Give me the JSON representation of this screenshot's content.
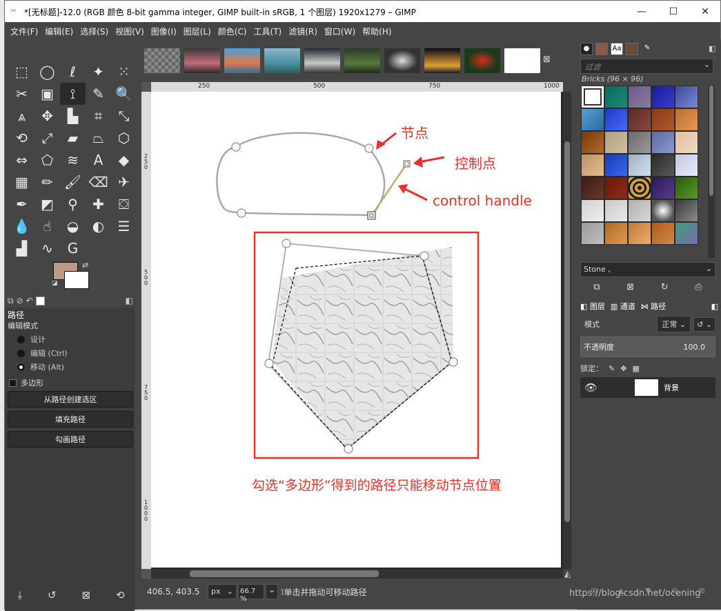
{
  "window": {
    "title": "*[无标题]-12.0 (RGB 颜色 8-bit gamma integer, GIMP built-in sRGB, 1 个图层) 1920x1279 – GIMP",
    "controls": {
      "minimize": "—",
      "maximize": "☐",
      "close": "✕"
    }
  },
  "menubar": {
    "items": [
      "文件(F)",
      "编辑(E)",
      "选择(S)",
      "视图(V)",
      "图像(I)",
      "图层(L)",
      "颜色(C)",
      "工具(T)",
      "滤镜(R)",
      "窗口(W)",
      "帮助(H)"
    ]
  },
  "ruler": {
    "h_labels": [
      "250",
      "500",
      "750",
      "1000"
    ],
    "v_labels": [
      "2\n5\n0",
      "5\n0\n0",
      "7\n5\n0",
      "1\n0\n0\n0"
    ]
  },
  "tool_options": {
    "title": "路径",
    "edit_mode_label": "编辑模式",
    "modes": [
      {
        "label": "设计",
        "checked": false
      },
      {
        "label": "编辑 (Ctrl)",
        "checked": false
      },
      {
        "label": "移动 (Alt)",
        "checked": true
      }
    ],
    "polygon_label": "多边形",
    "buttons": [
      "从路径创建选区",
      "填充路径",
      "勾画路径"
    ]
  },
  "status": {
    "coords": "406.5, 403.5",
    "unit": "px",
    "zoom": "66.7 %",
    "message": "单击并拖动可移动路径"
  },
  "brushes": {
    "filter_placeholder": "过滤",
    "section_label": "Bricks (96 × 96)",
    "selected_tag": "Stone ,"
  },
  "layers": {
    "tabs": [
      "图层",
      "通道",
      "路径"
    ],
    "mode_label": "模式",
    "mode_value": "正常",
    "opacity_label": "不透明度",
    "opacity_value": "100.0",
    "lock_label": "锁定：",
    "layer_name": "背景"
  },
  "annotations": {
    "node": "节点",
    "control_point": "控制点",
    "control_handle": "control handle",
    "caption": "勾选“多边形”得到的路径只能移动节点位置"
  },
  "watermark": "https://blog.csdn.net/ocening",
  "colors": {
    "accent_red": "#e8302a",
    "fg_color": "#bc9a85",
    "panel_bg": "#454545"
  }
}
